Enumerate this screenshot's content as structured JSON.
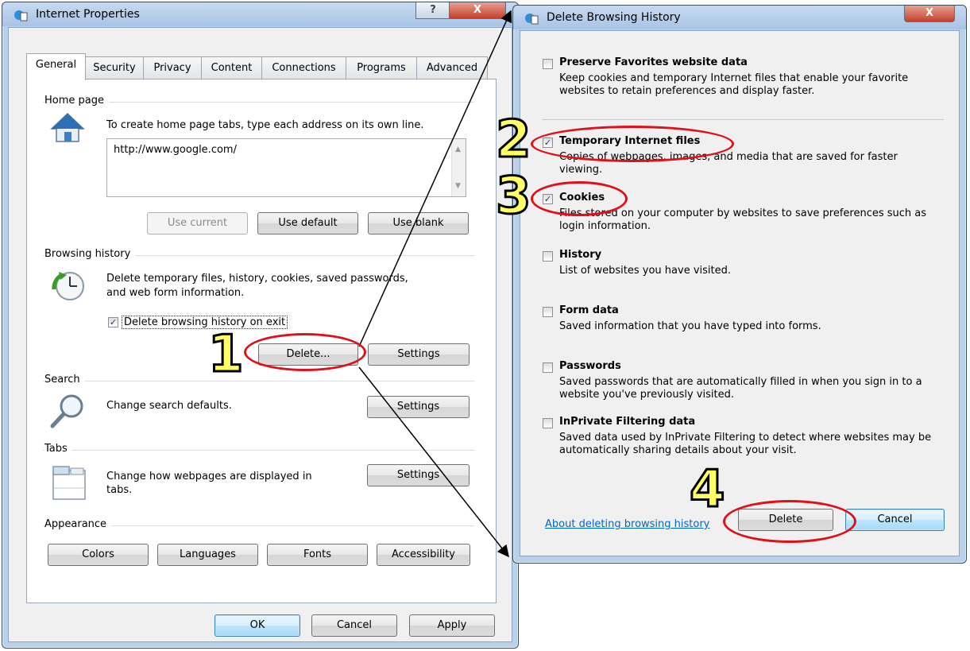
{
  "internet_properties": {
    "title": "Internet Properties",
    "title_buttons": [
      "?",
      "X"
    ],
    "tabs": [
      "General",
      "Security",
      "Privacy",
      "Content",
      "Connections",
      "Programs",
      "Advanced"
    ],
    "home_page": {
      "group_label": "Home page",
      "instruction": "To create home page tabs, type each address on its own line.",
      "url_value": "http://www.google.com/",
      "use_current": "Use current",
      "use_default": "Use default",
      "use_blank": "Use blank"
    },
    "browsing_history": {
      "group_label": "Browsing history",
      "description_line1": "Delete temporary files, history, cookies, saved passwords,",
      "description_line2": "and web form information.",
      "delete_on_exit_label": "Delete browsing history on exit",
      "delete_on_exit_checked": true,
      "delete_button": "Delete...",
      "settings_button": "Settings"
    },
    "search": {
      "group_label": "Search",
      "description": "Change search defaults.",
      "settings_button": "Settings"
    },
    "tabs_section": {
      "group_label": "Tabs",
      "description_line1": "Change how webpages are displayed in",
      "description_line2": "tabs.",
      "settings_button": "Settings"
    },
    "appearance": {
      "group_label": "Appearance",
      "colors": "Colors",
      "languages": "Languages",
      "fonts": "Fonts",
      "accessibility": "Accessibility"
    },
    "ok": "OK",
    "cancel": "Cancel",
    "apply": "Apply"
  },
  "delete_history": {
    "title": "Delete Browsing History",
    "close_button": "X",
    "options": [
      {
        "title": "Preserve Favorites website data",
        "desc": "Keep cookies and temporary Internet files that enable your favorite websites to retain preferences and display faster.",
        "checked": false
      },
      {
        "title": "Temporary Internet files",
        "desc": "Copies of webpages, images, and media that are saved for faster viewing.",
        "checked": true
      },
      {
        "title": "Cookies",
        "desc": "Files stored on your computer by websites to save preferences such as login information.",
        "checked": true
      },
      {
        "title": "History",
        "desc": "List of websites you have visited.",
        "checked": false
      },
      {
        "title": "Form data",
        "desc": "Saved information that you have typed into forms.",
        "checked": false
      },
      {
        "title": "Passwords",
        "desc": "Saved passwords that are automatically filled in when you sign in to a website you've previously visited.",
        "checked": false
      },
      {
        "title": "InPrivate Filtering data",
        "desc": "Saved data used by InPrivate Filtering to detect where websites may be automatically sharing details about your visit.",
        "checked": false
      }
    ],
    "about_link": "About deleting browsing history",
    "delete_button": "Delete",
    "cancel_button": "Cancel"
  },
  "annotations": {
    "step1": "1",
    "step2": "2",
    "step3": "3",
    "step4": "4",
    "highlight_color": "#e0101a",
    "number_fill": "#ffff66"
  }
}
